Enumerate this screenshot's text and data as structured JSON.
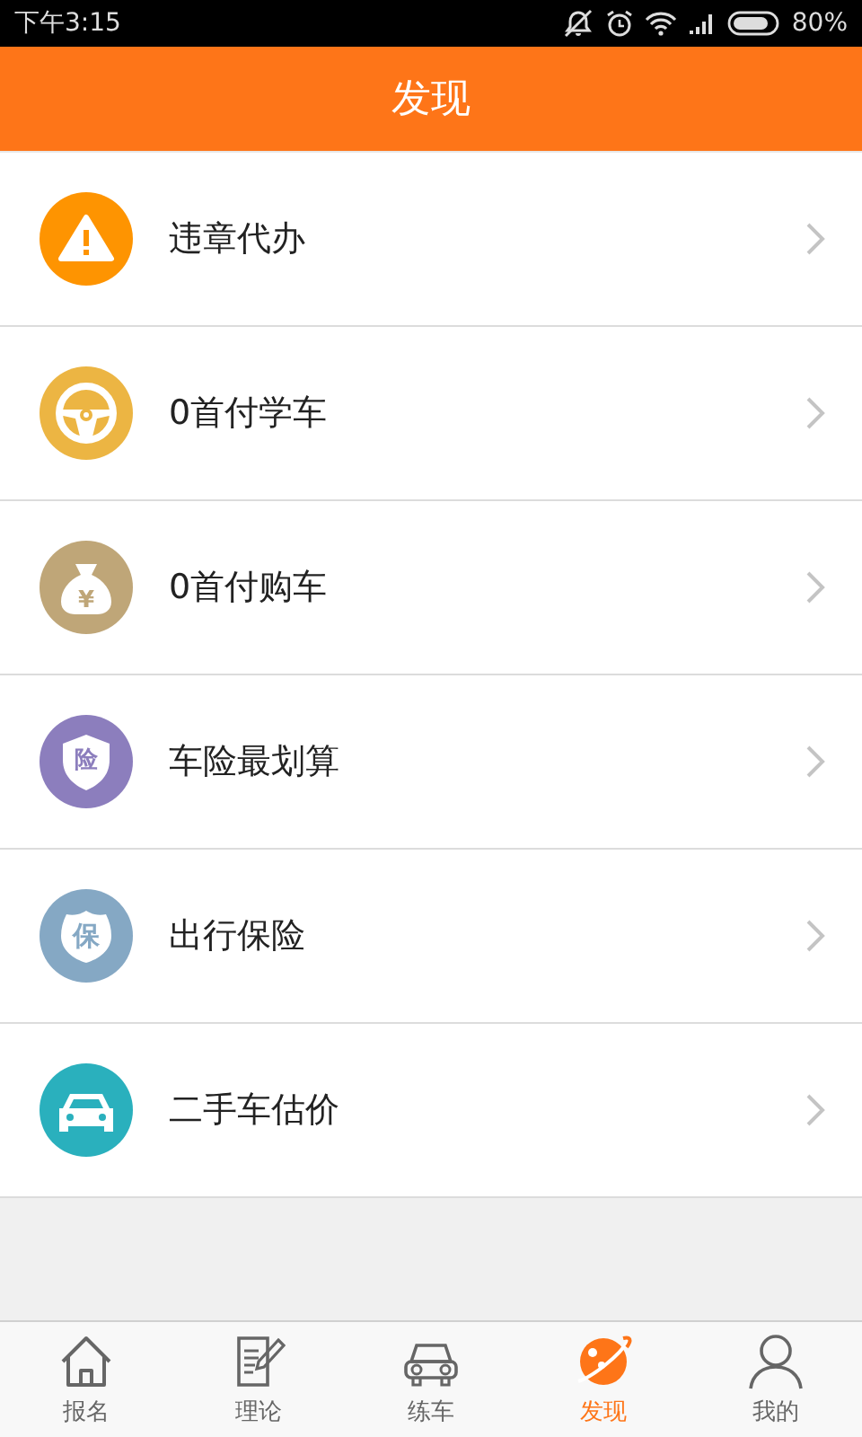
{
  "status_bar": {
    "time": "下午3:15",
    "battery": "80%"
  },
  "header": {
    "title": "发现"
  },
  "items": [
    {
      "label": "违章代办",
      "kind": "warning",
      "color": "#fe9401"
    },
    {
      "label": "0首付学车",
      "kind": "wheel",
      "color": "#ecb543"
    },
    {
      "label": "0首付购车",
      "kind": "moneybag",
      "color": "#bfa678",
      "glyph": "¥"
    },
    {
      "label": "车险最划算",
      "kind": "shield",
      "color": "#8c7ebd",
      "glyph": "险"
    },
    {
      "label": "出行保险",
      "kind": "badge",
      "color": "#85a8c4",
      "glyph": "保"
    },
    {
      "label": "二手车估价",
      "kind": "car",
      "color": "#2ab0bd"
    }
  ],
  "tabs": [
    {
      "label": "报名",
      "kind": "home",
      "selected": false
    },
    {
      "label": "理论",
      "kind": "document",
      "selected": false
    },
    {
      "label": "练车",
      "kind": "car",
      "selected": false
    },
    {
      "label": "发现",
      "kind": "planet",
      "selected": true
    },
    {
      "label": "我的",
      "kind": "person",
      "selected": false
    }
  ]
}
